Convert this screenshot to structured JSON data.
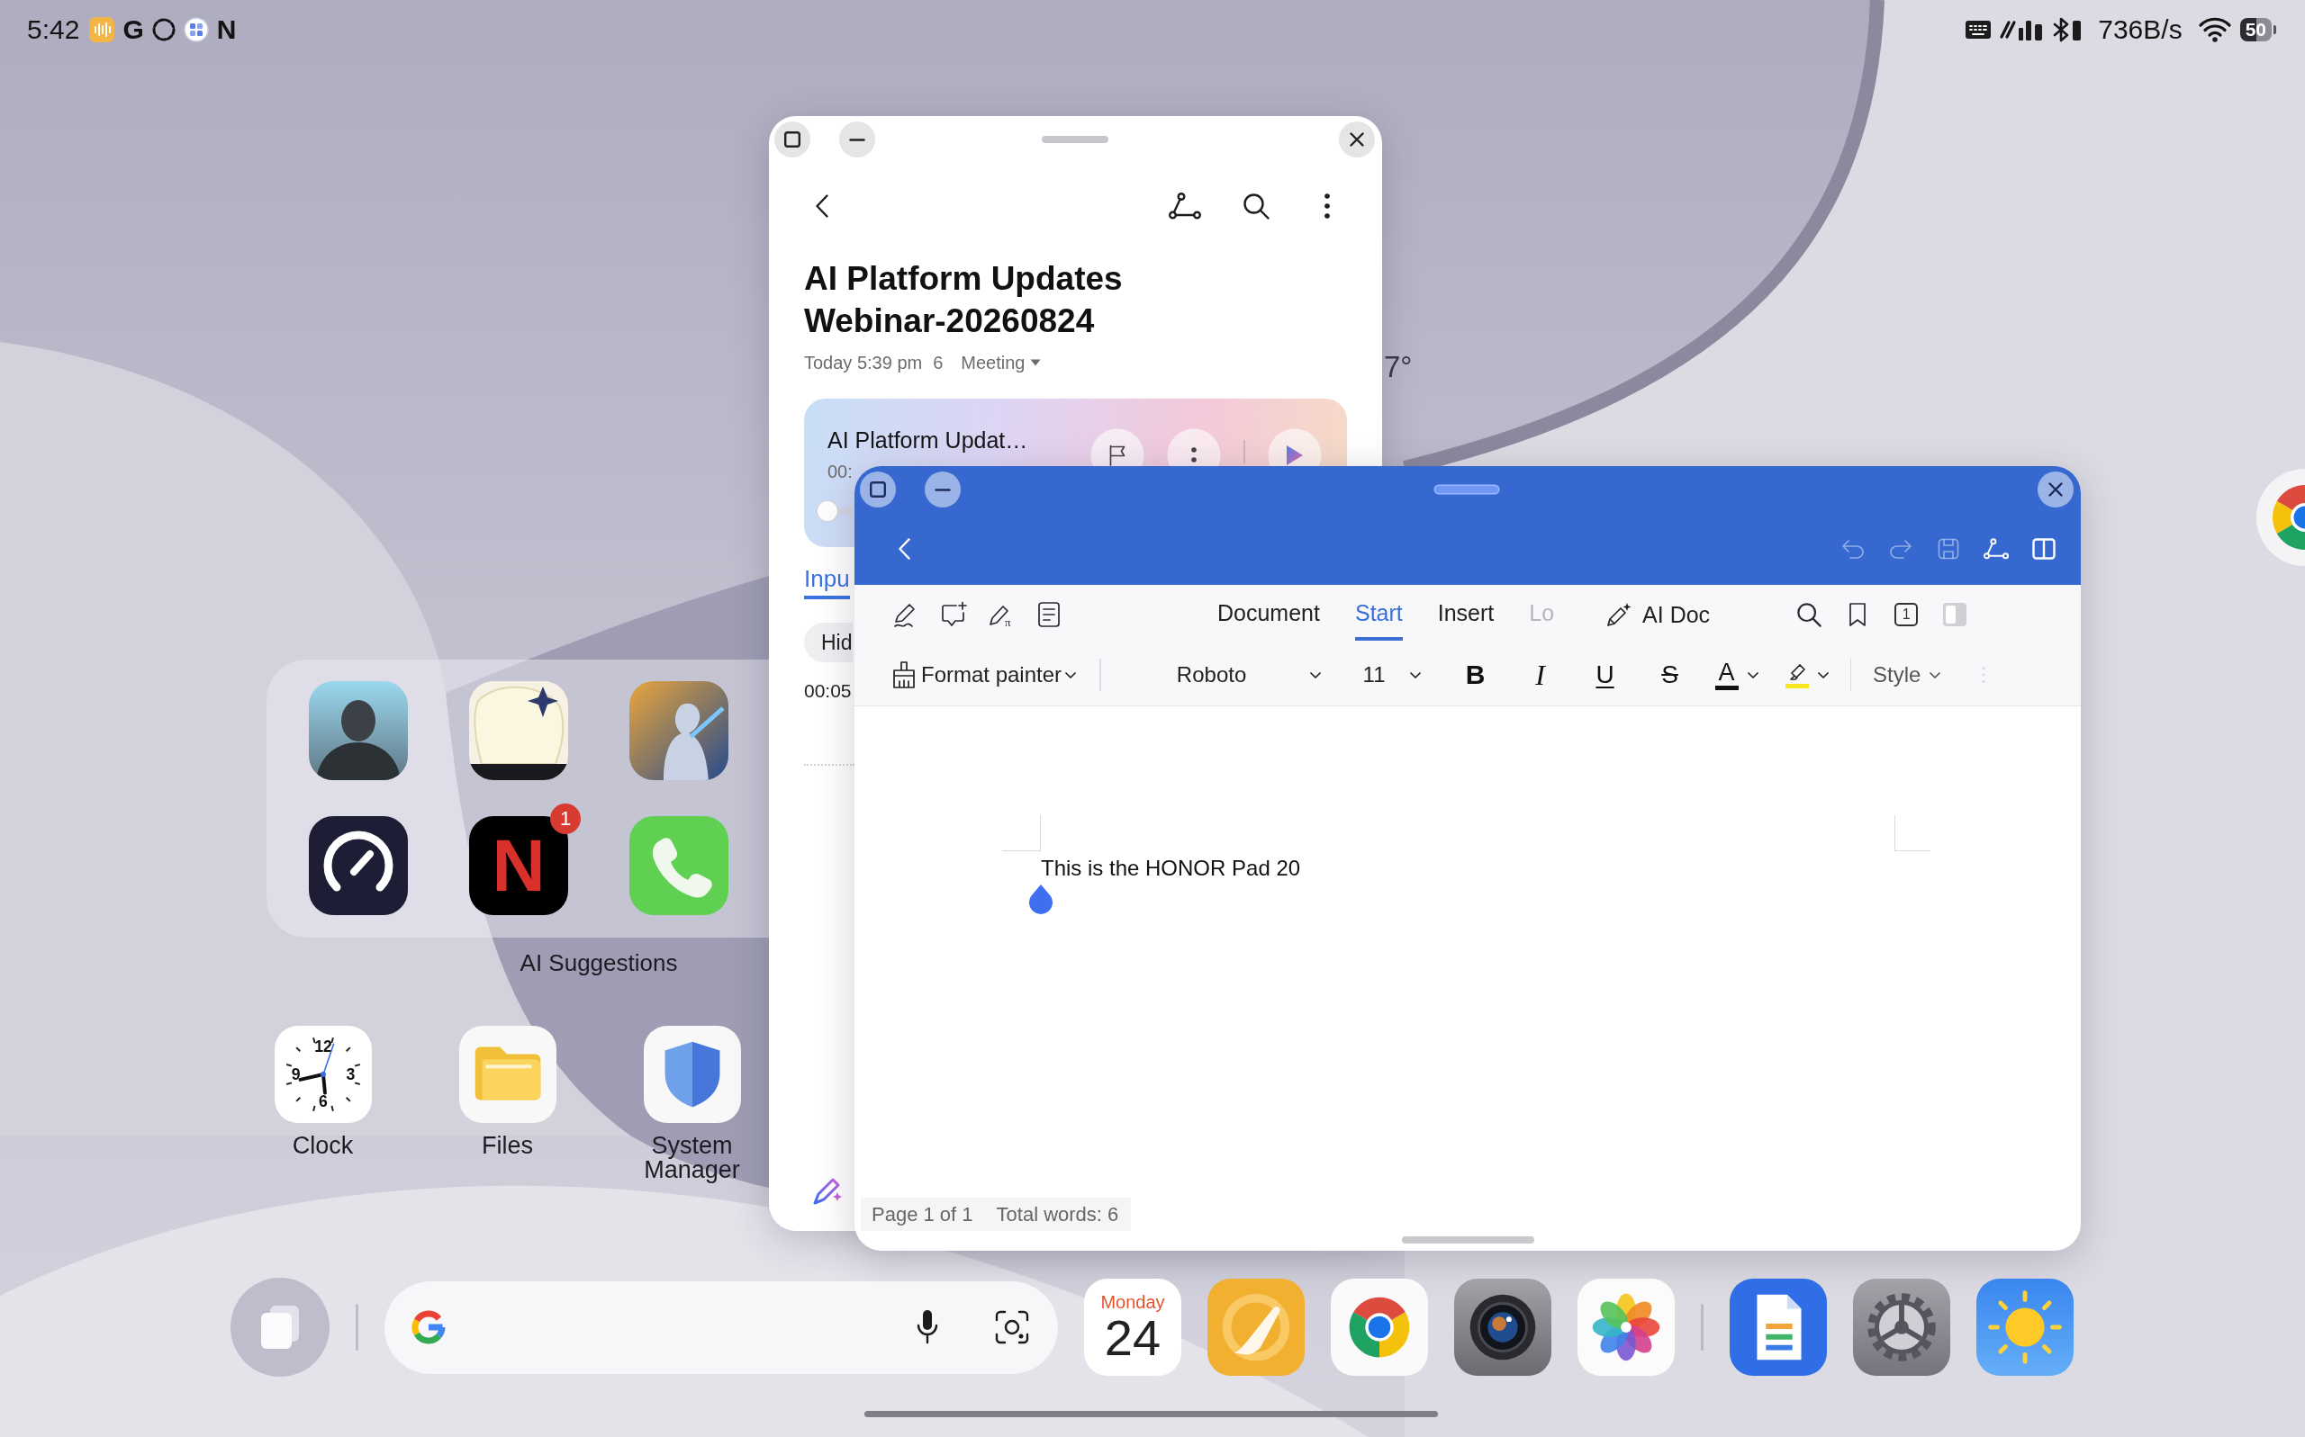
{
  "status_bar": {
    "time": "5:42",
    "notification_letters": [
      "G",
      "N"
    ],
    "net_speed": "736B/s",
    "battery": "50"
  },
  "weather_widget": {
    "temperature": "7°"
  },
  "home_folder": {
    "name": "AI Suggestions",
    "apps": [
      {
        "kind": "game-soldier"
      },
      {
        "kind": "game-anime"
      },
      {
        "kind": "game-battle"
      },
      {
        "kind": "speedometer"
      },
      {
        "kind": "letter",
        "glyph": "N",
        "badge": "1"
      },
      {
        "kind": "phone"
      }
    ]
  },
  "home_apps": [
    {
      "kind": "clock",
      "label": "Clock",
      "dial": [
        "12",
        "3",
        "6",
        "9"
      ]
    },
    {
      "kind": "files",
      "label": "Files"
    },
    {
      "kind": "shield",
      "label": "System Manager"
    }
  ],
  "notes_window": {
    "title": "AI Platform Updates Webinar-20260824",
    "date": "Today 5:39 pm",
    "count": "6",
    "category": "Meeting",
    "recording": {
      "title": "AI Platform Updat…",
      "time": "00:",
      "level": 0
    },
    "tabs": [
      {
        "label": "Inpu",
        "selected": true
      }
    ],
    "chips": [
      "Hid"
    ],
    "timestamp": "00:05"
  },
  "wps_window": {
    "header_actions": [
      {
        "kind": "undo",
        "disabled": true
      },
      {
        "kind": "redo",
        "disabled": true
      },
      {
        "kind": "save",
        "disabled": true
      },
      {
        "kind": "share",
        "disabled": false
      },
      {
        "kind": "split",
        "disabled": false
      }
    ],
    "formula_glyph": "π",
    "tabs": [
      {
        "label": "Document",
        "selected": false
      },
      {
        "label": "Start",
        "selected": true
      },
      {
        "label": "Insert",
        "selected": false
      },
      {
        "label": "Lo",
        "selected": false
      }
    ],
    "ai_button": "AI Doc",
    "page_count": "1",
    "format_painter": "Format painter",
    "font": "Roboto",
    "font_size": "11",
    "text_styles": [
      {
        "kind": "bold",
        "glyph": "B"
      },
      {
        "kind": "italic",
        "glyph": "I"
      },
      {
        "kind": "underline",
        "glyph": "U"
      },
      {
        "kind": "strike",
        "glyph": "S"
      }
    ],
    "color_tools": [
      {
        "kind": "font-color",
        "glyph": "A",
        "color": "#111111"
      },
      {
        "kind": "highlight",
        "color": "#f5e61e"
      }
    ],
    "style_menu": "Style",
    "body_text": "This is the HONOR Pad 20",
    "page_info": "Page 1 of 1",
    "word_count": "Total words: 6"
  },
  "dock": {
    "app_groups": [
      [
        {
          "kind": "calendar",
          "weekday": "Monday",
          "day": "24"
        },
        {
          "kind": "brush"
        },
        {
          "kind": "browser"
        },
        {
          "kind": "camera"
        },
        {
          "kind": "pinwheel"
        }
      ],
      [
        {
          "kind": "document"
        },
        {
          "kind": "settings"
        },
        {
          "kind": "weather"
        }
      ]
    ]
  }
}
